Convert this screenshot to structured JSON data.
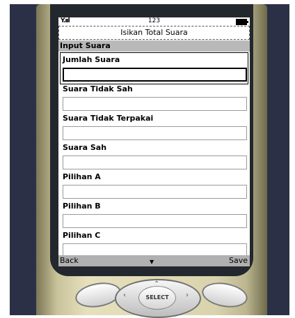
{
  "status_bar": {
    "signal": "Y.ııl",
    "clock": "123"
  },
  "title": "Isikan Total Suara",
  "section_header": "Input Suara",
  "fields": [
    {
      "label": "Jumlah Suara",
      "value": ""
    },
    {
      "label": "Suara Tidak Sah",
      "value": ""
    },
    {
      "label": "Suara Tidak Terpakai",
      "value": ""
    },
    {
      "label": "Suara Sah",
      "value": ""
    },
    {
      "label": "Pilihan A",
      "value": ""
    },
    {
      "label": "Pilihan B",
      "value": ""
    },
    {
      "label": "Pilihan C",
      "value": ""
    }
  ],
  "softkeys": {
    "left": "Back",
    "right": "Save",
    "scroll_indicator": "down-arrow-icon"
  },
  "keypad": {
    "select_label": "SELECT"
  }
}
